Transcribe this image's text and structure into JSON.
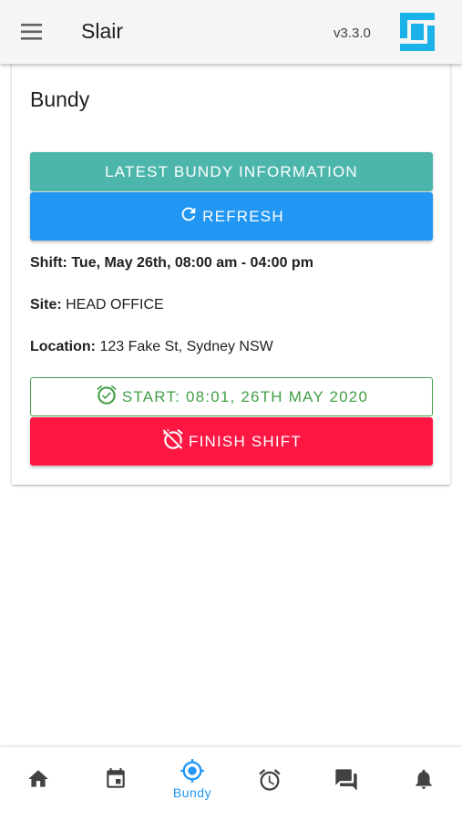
{
  "header": {
    "app_title": "Slair",
    "version": "v3.3.0",
    "logo_color": "#1ab2e8"
  },
  "card": {
    "title": "Bundy",
    "latest_button": "LATEST BUNDY INFORMATION",
    "refresh_button": "REFRESH",
    "shift_label": "Shift:",
    "shift_value": "Tue, May 26th, 08:00 am - 04:00 pm",
    "site_label": "Site:",
    "site_value": "HEAD OFFICE",
    "location_label": "Location:",
    "location_value": "123 Fake St, Sydney NSW",
    "start_button": "START: 08:01, 26TH MAY 2020",
    "finish_button": "FINISH SHIFT"
  },
  "colors": {
    "latest": "#4db6ac",
    "refresh": "#2196f3",
    "start": "#43a047",
    "finish": "#ff1744",
    "active_nav": "#2196f3",
    "inactive_nav": "#424242"
  },
  "bottom_nav": [
    {
      "icon": "home-icon",
      "label": ""
    },
    {
      "icon": "calendar-icon",
      "label": ""
    },
    {
      "icon": "crosshair-icon",
      "label": "Bundy",
      "active": true
    },
    {
      "icon": "alarm-clock-icon",
      "label": ""
    },
    {
      "icon": "chat-icon",
      "label": ""
    },
    {
      "icon": "bell-icon",
      "label": ""
    }
  ]
}
